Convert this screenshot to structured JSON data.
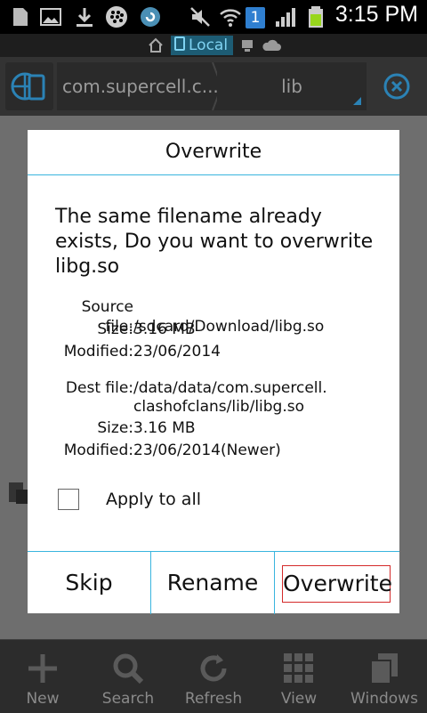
{
  "status_bar": {
    "time": "3:15 PM",
    "notification_badge": "1",
    "icons": [
      "sim-icon",
      "image-icon",
      "download-icon",
      "blackberry-icon",
      "sync-icon",
      "mute-icon",
      "wifi-icon",
      "signal-icon",
      "battery-icon"
    ]
  },
  "location_bar": {
    "local_label": "Local"
  },
  "path_bar": {
    "segment_1": "com.supercell.c...",
    "segment_2": "lib"
  },
  "toolbar": {
    "items": [
      {
        "label": "New",
        "icon": "plus-icon"
      },
      {
        "label": "Search",
        "icon": "search-icon"
      },
      {
        "label": "Refresh",
        "icon": "refresh-icon"
      },
      {
        "label": "View",
        "icon": "grid-icon"
      },
      {
        "label": "Windows",
        "icon": "windows-icon"
      }
    ]
  },
  "dialog": {
    "title": "Overwrite",
    "message": "The same filename already exists, Do you want to overwrite libg.so",
    "source": {
      "file_label": "Source file:",
      "file_value": "/sdcard/Download/libg.so",
      "size_label": "Size:",
      "size_value": "3.16 MB",
      "modified_label": "Modified:",
      "modified_value": "23/06/2014"
    },
    "dest": {
      "file_label": "Dest file:",
      "file_value_line1": "/data/data/com.supercell.",
      "file_value_line2": "clashofclans/lib/libg.so",
      "size_label": "Size:",
      "size_value": "3.16 MB",
      "modified_label": "Modified:",
      "modified_value": "23/06/2014(Newer)"
    },
    "apply_all_label": "Apply to all",
    "apply_all_checked": false,
    "buttons": {
      "skip": "Skip",
      "rename": "Rename",
      "overwrite": "Overwrite"
    }
  },
  "colors": {
    "accent": "#39b5de",
    "focus_border": "#d42a2a",
    "overlay": "#6e6e6e"
  }
}
